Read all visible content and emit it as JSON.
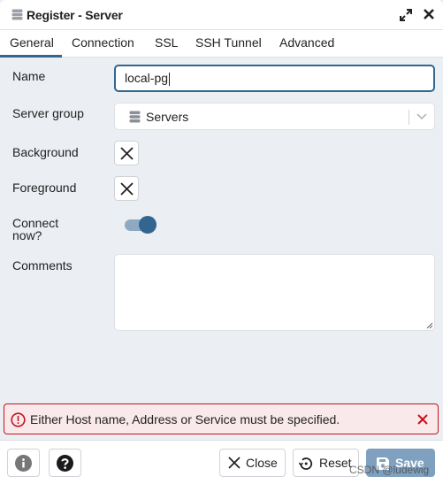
{
  "dialog": {
    "title": "Register - Server",
    "icons": {
      "title": "server-group-icon",
      "expand": "expand-icon",
      "close": "close-icon"
    }
  },
  "tabs": [
    {
      "label": "General",
      "active": true
    },
    {
      "label": "Connection",
      "active": false
    },
    {
      "label": "SSL",
      "active": false
    },
    {
      "label": "SSH Tunnel",
      "active": false
    },
    {
      "label": "Advanced",
      "active": false
    }
  ],
  "form": {
    "name": {
      "label": "Name",
      "value": "local-pg"
    },
    "server_group": {
      "label": "Server group",
      "value": "Servers"
    },
    "background": {
      "label": "Background",
      "value": "none"
    },
    "foreground": {
      "label": "Foreground",
      "value": "none"
    },
    "connect_now": {
      "label_line1": "Connect",
      "label_line2": "now?",
      "checked": true
    },
    "comments": {
      "label": "Comments",
      "value": ""
    }
  },
  "error": {
    "message": "Either Host name, Address or Service must be specified."
  },
  "footer": {
    "close_label": "Close",
    "reset_label": "Reset",
    "save_label": "Save"
  },
  "watermark": "CSDN @ludewig",
  "colors": {
    "accent": "#326690",
    "error": "#c6121c",
    "error_bg": "#f9e9ea",
    "save_disabled": "#7fa0bf"
  }
}
